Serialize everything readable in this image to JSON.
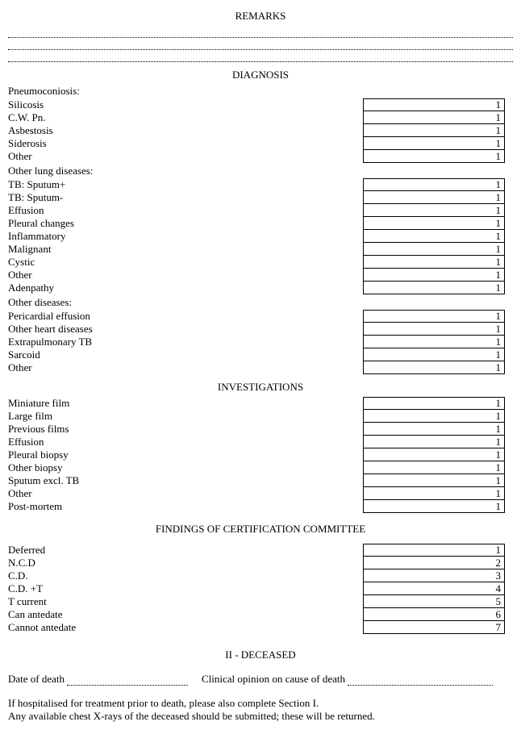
{
  "remarks": {
    "heading": "REMARKS"
  },
  "diagnosis": {
    "heading": "DIAGNOSIS",
    "group_pneumo": "Pneumoconiosis:",
    "pneumo": [
      {
        "label": "Silicosis",
        "value": "1"
      },
      {
        "label": "C.W. Pn.",
        "value": "1"
      },
      {
        "label": "Asbestosis",
        "value": "1"
      },
      {
        "label": "Siderosis",
        "value": "1"
      },
      {
        "label": "Other",
        "value": "1"
      }
    ],
    "group_other_lung": "Other lung diseases:",
    "other_lung": [
      {
        "label": "TB:  Sputum+",
        "value": "1"
      },
      {
        "label": "TB:  Sputum-",
        "value": "1"
      },
      {
        "label": "Effusion",
        "value": "1"
      },
      {
        "label": "Pleural changes",
        "value": "1"
      },
      {
        "label": "Inflammatory",
        "value": "1"
      },
      {
        "label": "Malignant",
        "value": "1"
      },
      {
        "label": "Cystic",
        "value": "1"
      },
      {
        "label": "Other",
        "value": "1"
      },
      {
        "label": "Adenpathy",
        "value": "1"
      }
    ],
    "group_other_dis": "Other diseases:",
    "other_dis": [
      {
        "label": "Pericardial effusion",
        "value": "1"
      },
      {
        "label": "Other heart diseases",
        "value": "1"
      },
      {
        "label": "Extrapulmonary TB",
        "value": "1"
      },
      {
        "label": "Sarcoid",
        "value": "1"
      },
      {
        "label": "Other",
        "value": "1"
      }
    ]
  },
  "investigations": {
    "heading": "INVESTIGATIONS",
    "items": [
      {
        "label": "Miniature film",
        "value": "1"
      },
      {
        "label": "Large film",
        "value": "1"
      },
      {
        "label": "Previous films",
        "value": "1"
      },
      {
        "label": "Effusion",
        "value": "1"
      },
      {
        "label": "Pleural biopsy",
        "value": "1"
      },
      {
        "label": "Other biopsy",
        "value": "1"
      },
      {
        "label": "Sputum excl. TB",
        "value": "1"
      },
      {
        "label": "Other",
        "value": "1"
      },
      {
        "label": "Post-mortem",
        "value": "1"
      }
    ]
  },
  "findings": {
    "heading": "FINDINGS OF CERTIFICATION COMMITTEE",
    "items": [
      {
        "label": "Deferred",
        "value": "1"
      },
      {
        "label": "N.C.D",
        "value": "2"
      },
      {
        "label": "C.D.",
        "value": "3"
      },
      {
        "label": "C.D. +T",
        "value": "4"
      },
      {
        "label": "T current",
        "value": "5"
      },
      {
        "label": "Can antedate",
        "value": "6"
      },
      {
        "label": "Cannot antedate",
        "value": "7"
      }
    ]
  },
  "deceased": {
    "heading": "II - DECEASED",
    "date_of_death_label": "Date of death",
    "clinical_opinion_label": "Clinical opinion on cause of death",
    "note1": "If hospitalised for treatment prior to death, please also complete Section I.",
    "note2": "Any available chest X-rays of the deceased should be submitted; these will be returned."
  }
}
